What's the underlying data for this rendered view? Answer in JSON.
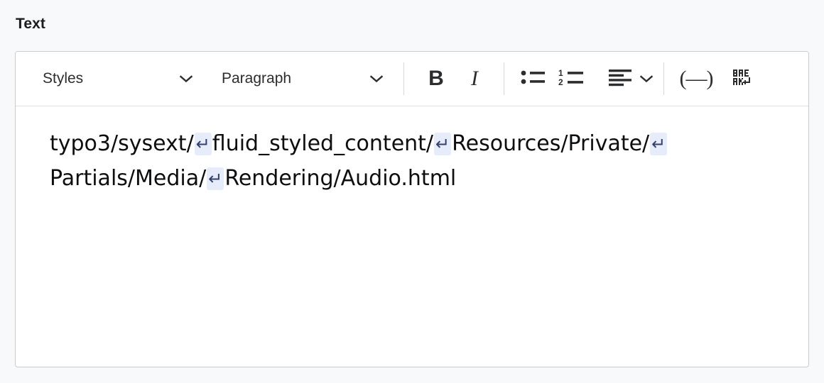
{
  "field": {
    "label": "Text"
  },
  "toolbar": {
    "styles_dropdown": {
      "value": "Styles",
      "chevron_icon": "chevron-down-icon"
    },
    "format_dropdown": {
      "value": "Paragraph",
      "chevron_icon": "chevron-down-icon"
    },
    "buttons": [
      {
        "name": "bold-button",
        "icon": "bold-icon",
        "glyph": "B"
      },
      {
        "name": "italic-button",
        "icon": "italic-icon",
        "glyph": "I"
      },
      {
        "name": "bulleted-list-button",
        "icon": "bulleted-list-icon"
      },
      {
        "name": "numbered-list-button",
        "icon": "numbered-list-icon"
      },
      {
        "name": "text-alignment-button",
        "icon": "align-left-icon"
      },
      {
        "name": "special-character-button",
        "icon": "special-character-icon",
        "glyph": "(—)"
      },
      {
        "name": "soft-line-break-button",
        "icon": "break-icon",
        "glyph": "BREAK"
      }
    ]
  },
  "content": {
    "paragraph_segments": [
      {
        "type": "text",
        "value": "typo3/sysext/"
      },
      {
        "type": "break",
        "value": "↵"
      },
      {
        "type": "text",
        "value": "fluid_styled_content/"
      },
      {
        "type": "break",
        "value": "↵"
      },
      {
        "type": "text",
        "value": "Resources/Private/"
      },
      {
        "type": "break",
        "value": "↵"
      },
      {
        "type": "text",
        "value": "Partials/Media/"
      },
      {
        "type": "break",
        "value": "↵"
      },
      {
        "type": "text",
        "value": "Rendering/Audio.html"
      }
    ],
    "plain_text": "typo3/sysext/↵fluid_styled_content/↵Resources/Private/↵Partials/Media/↵Rendering/Audio.html"
  },
  "colors": {
    "page_background": "#f8f9fa",
    "editor_background": "#ffffff",
    "border": "#c8ccd1",
    "toolbar_divider": "#dfe2e5",
    "separator": "#d5d9dd",
    "icon": "#2b2d2f",
    "text": "#0d0e10",
    "break_marker_background": "#e6ecf9",
    "break_marker_foreground": "#33406e"
  }
}
